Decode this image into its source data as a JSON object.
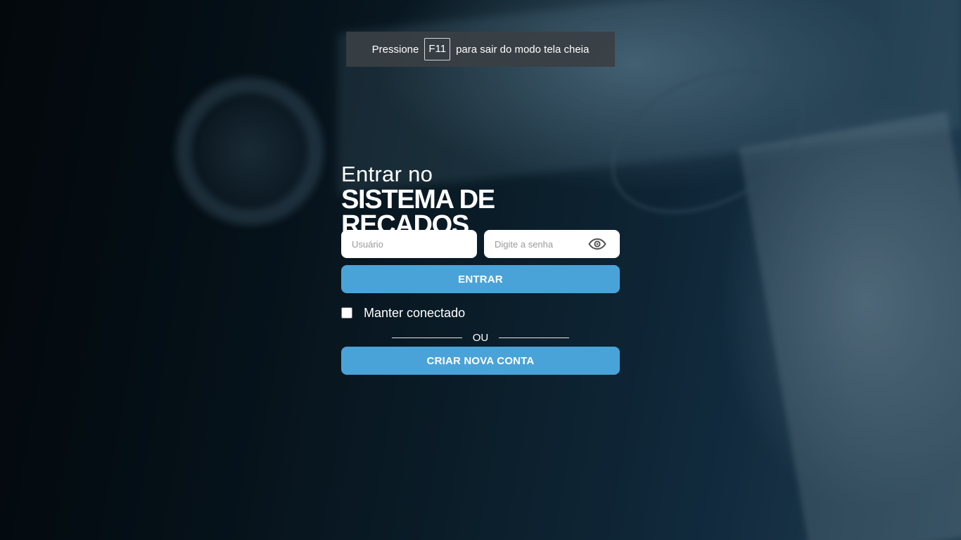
{
  "fullscreen_notice": {
    "before": "Pressione",
    "key": "F11",
    "after": "para sair do modo tela cheia"
  },
  "login": {
    "title_small": "Entrar no",
    "title_big": "SISTEMA DE RECADOS",
    "username_placeholder": "Usuário",
    "password_placeholder": "Digite a senha",
    "password_toggle_icon": "eye-icon",
    "enter_label": "ENTRAR",
    "keep_connected_label": "Manter conectado",
    "divider_text": "OU",
    "create_account_label": "CRIAR NOVA CONTA"
  },
  "colors": {
    "button": "#4aa3d8",
    "text": "#ffffff",
    "notice_bg": "#3a3f44"
  }
}
